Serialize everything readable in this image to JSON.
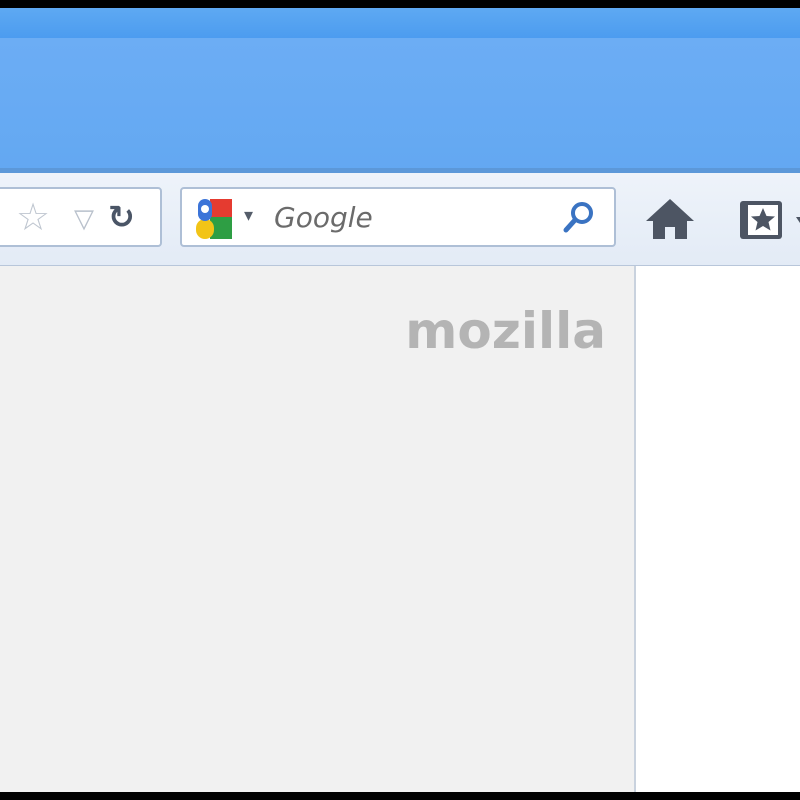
{
  "search": {
    "placeholder": "Google",
    "engine_icon": "google-logo-icon"
  },
  "content": {
    "brand": "mozilla"
  },
  "icons": {
    "bookmark_star": "star-outline-icon",
    "history_dropdown": "triangle-down-icon",
    "reload": "reload-icon",
    "search_go": "magnifier-icon",
    "home": "home-icon",
    "bookmarks_menu": "bookmark-star-box-icon"
  },
  "colors": {
    "title_bar": "#4c9cf0",
    "tab_strip": "#63a8f2",
    "nav_bar": "#e8eef7",
    "page_background": "#f1f1f1",
    "brand_text": "#b4b4b4"
  }
}
